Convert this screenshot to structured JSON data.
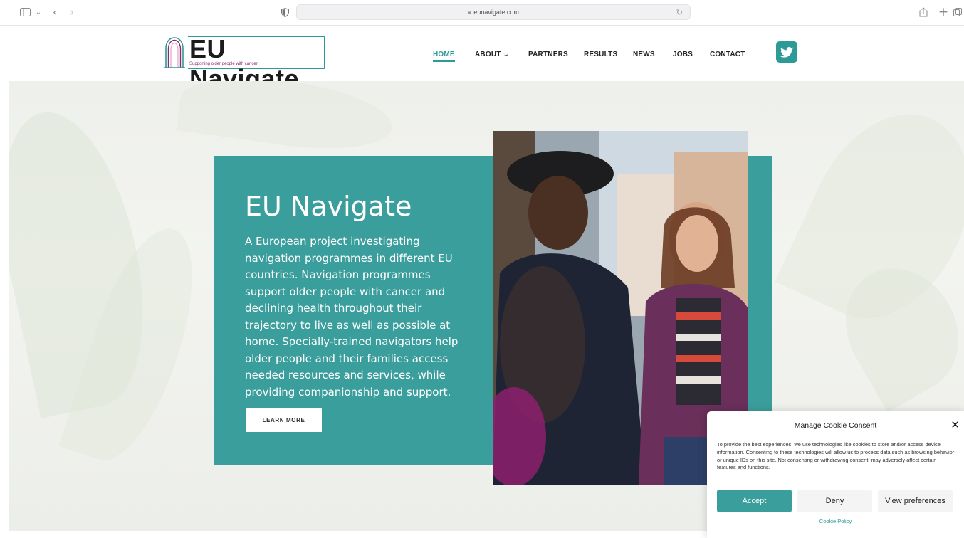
{
  "browser": {
    "url": "eunavigate.com"
  },
  "site": {
    "logo_title": "EU Navigate",
    "logo_tagline": "Supporting older people with cancer",
    "nav": [
      {
        "label": "HOME",
        "active": true
      },
      {
        "label": "ABOUT ⌄",
        "active": false
      },
      {
        "label": "PARTNERS",
        "active": false
      },
      {
        "label": "RESULTS",
        "active": false
      },
      {
        "label": "NEWS",
        "active": false
      },
      {
        "label": "JOBS",
        "active": false
      },
      {
        "label": "CONTACT",
        "active": false
      }
    ],
    "social_icon": "twitter-icon"
  },
  "hero": {
    "title": "EU Navigate",
    "text": "A European project investigating navigation programmes in different EU countries. Navigation programmes support older people with cancer and declining health throughout their trajectory to live as well as possible at home. Specially-trained navigators help older people and their families access needed resources and services, while providing companionship and support.",
    "button": "LEARN MORE"
  },
  "cookie": {
    "title": "Manage Cookie Consent",
    "text": "To provide the best experiences, we use technologies like cookies to store and/or access device information. Consenting to these technologies will allow us to process data such as browsing behavior or unique IDs on this site. Not consenting or withdrawing consent, may adversely affect certain features and functions.",
    "accept": "Accept",
    "deny": "Deny",
    "preferences": "View preferences",
    "policy": "Cookie Policy"
  },
  "colors": {
    "accent": "#3a9e9c"
  }
}
